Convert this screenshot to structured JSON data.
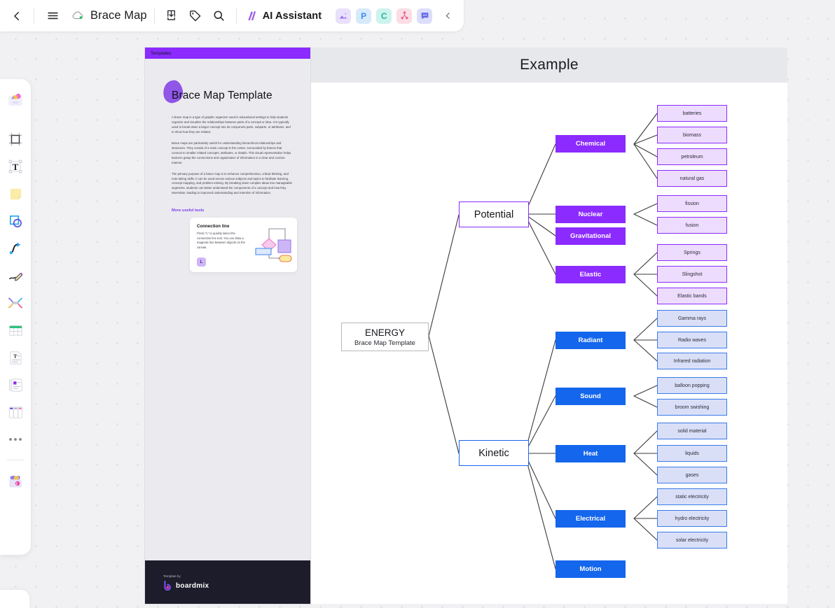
{
  "topbar": {
    "back_icon": "chevron-left-icon",
    "menu_icon": "hamburger-menu-icon",
    "cloud_icon": "cloud-saved-icon",
    "doc_title": "Brace Map",
    "export_icon": "export-download-icon",
    "tag_icon": "tag-icon",
    "search_icon": "search-icon",
    "ai_label": "AI Assistant",
    "app_chips": [
      {
        "name": "ai-image-app",
        "glyph": "image",
        "bg": "#e9e0fb"
      },
      {
        "name": "presentation-app",
        "glyph": "P",
        "bg": "#d7eafb"
      },
      {
        "name": "mindmap-app",
        "glyph": "C",
        "bg": "#cdf3ec"
      },
      {
        "name": "flowchart-app",
        "glyph": "node",
        "bg": "#fbdde6"
      },
      {
        "name": "comment-app",
        "glyph": "speech",
        "bg": "#dcdefb"
      }
    ],
    "collapse_icon": "chevron-left-icon"
  },
  "left_rail": {
    "items": [
      {
        "name": "templates-tool",
        "label": "Templates"
      },
      {
        "name": "frame-tool",
        "label": "Frame"
      },
      {
        "name": "text-tool",
        "label": "Text"
      },
      {
        "name": "sticky-note-tool",
        "label": "Sticky note"
      },
      {
        "name": "shape-tool",
        "label": "Shape"
      },
      {
        "name": "connector-tool",
        "label": "Connection line"
      },
      {
        "name": "pen-tool",
        "label": "Pen"
      },
      {
        "name": "mindmap-tool",
        "label": "Mind map"
      },
      {
        "name": "table-tool",
        "label": "Table"
      },
      {
        "name": "document-tool",
        "label": "Document"
      },
      {
        "name": "card-tool",
        "label": "Card"
      },
      {
        "name": "kanban-tool",
        "label": "Kanban"
      },
      {
        "name": "more-tools",
        "label": "More"
      },
      {
        "name": "resources-tool",
        "label": "Resources"
      }
    ]
  },
  "template_card": {
    "header_label": "Templates",
    "title": "Brace Map Template",
    "paragraphs": [
      "A brace map is a type of graphic organizer used in educational settings to help students organize and visualize the relationships between parts of a concept or idea. It is typically used to break down a larger concept into its component parts, subparts, or attributes, and to show how they are related.",
      "Brace maps are particularly useful for understanding hierarchical relationships and structures. They consist of a main concept in the center, surrounded by braces that connect to smaller related concepts, attributes, or details. This visual representation helps learners grasp the connections and organization of information in a clear and concise manner.",
      "The primary purpose of a brace map is to enhance comprehension, critical thinking, and note-taking skills. It can be used across various subjects and topics to facilitate learning, concept mapping, and problem-solving. By breaking down complex ideas into manageable segments, students can better understand the components of a concept and how they interrelate, leading to improved understanding and retention of information."
    ],
    "more_tools_title": "More useful tools",
    "tool_card": {
      "title": "Connection line",
      "description": "Press \"L\" to quickly select the connection line tool. You can draw a magnetic line between objects on the canvas.",
      "key": "L"
    },
    "footer_label": "Template by",
    "brand_name": "boardmix"
  },
  "board": {
    "title": "Example"
  },
  "chart_data": {
    "type": "diagram",
    "diagram_kind": "brace-map",
    "title": "Example",
    "root": {
      "title": "ENERGY",
      "subtitle": "Brace Map Template"
    },
    "colors": {
      "purple": "#8b2bff",
      "purple_light": "#eddcfd",
      "blue": "#1466ec",
      "blue_light": "#dadff8",
      "root_border": "#b9b9bf",
      "connector": "#3a3a3a"
    },
    "categories": [
      {
        "label": "Potential",
        "color": "purple",
        "branches": [
          {
            "label": "Chemical",
            "leaves": [
              "batteries",
              "biomass",
              "petroleum",
              "natural gas"
            ]
          },
          {
            "label": "Nuclear",
            "leaves": [
              "fission",
              "fusion"
            ]
          },
          {
            "label": "Gravitational",
            "leaves": []
          },
          {
            "label": "Elastic",
            "leaves": [
              "Springs",
              "Slingshot",
              "Elastic bands"
            ]
          }
        ]
      },
      {
        "label": "Kinetic",
        "color": "blue",
        "branches": [
          {
            "label": "Radiant",
            "leaves": [
              "Gamma rays",
              "Radio waves",
              "Infrared radiation"
            ]
          },
          {
            "label": "Sound",
            "leaves": [
              "balloon popping",
              "broom swishing"
            ]
          },
          {
            "label": "Heat",
            "leaves": [
              "solid material",
              "liquids",
              "gases"
            ]
          },
          {
            "label": "Electrical",
            "leaves": [
              "static electricity",
              "hydro electricity",
              "solar electricity"
            ]
          },
          {
            "label": "Motion",
            "leaves": []
          }
        ]
      }
    ]
  }
}
